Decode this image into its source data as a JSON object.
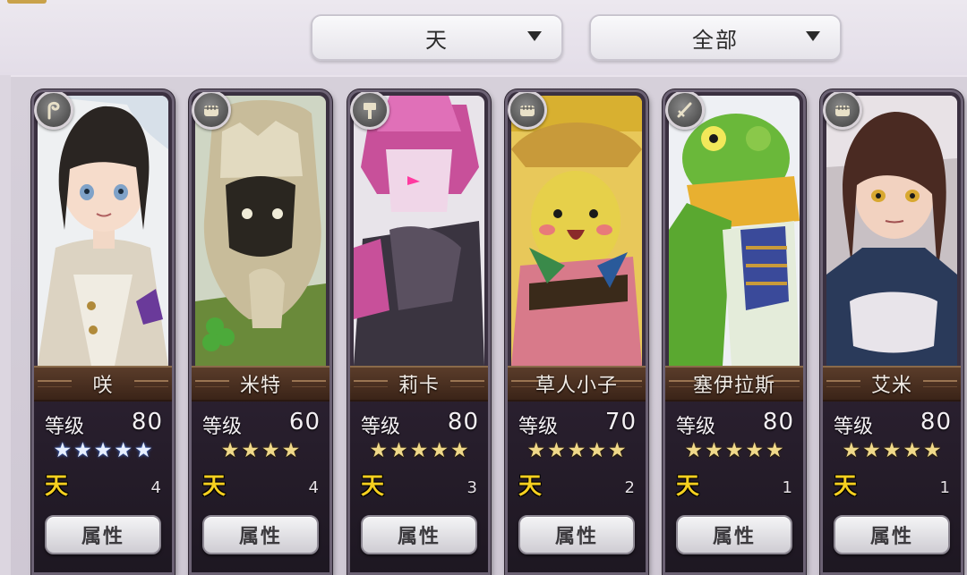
{
  "filters": {
    "rarity": {
      "selected": "天"
    },
    "category": {
      "selected": "全部"
    }
  },
  "level_label": "等级",
  "attr_label": "属性",
  "rank_badge": "天",
  "colors": {
    "card_border": "#6c6274",
    "name_bar": "#4a301f",
    "star_gold": "#f0d98a",
    "star_blue": "#e8f0ff",
    "rank_badge": "#f6d020"
  },
  "cards": [
    {
      "name": "咲",
      "level": "80",
      "stars": 5,
      "star_style": "blue",
      "count": "4",
      "type_icon": "whip-icon"
    },
    {
      "name": "米特",
      "level": "60",
      "stars": 4,
      "star_style": "gold",
      "count": "4",
      "type_icon": "fist-icon"
    },
    {
      "name": "莉卡",
      "level": "80",
      "stars": 5,
      "star_style": "gold",
      "count": "3",
      "type_icon": "hammer-icon"
    },
    {
      "name": "草人小子",
      "level": "70",
      "stars": 5,
      "star_style": "gold",
      "count": "2",
      "type_icon": "fist-icon"
    },
    {
      "name": "塞伊拉斯",
      "level": "80",
      "stars": 5,
      "star_style": "gold",
      "count": "1",
      "type_icon": "sword-icon"
    },
    {
      "name": "艾米",
      "level": "80",
      "stars": 5,
      "star_style": "gold",
      "count": "1",
      "type_icon": "fist-icon"
    }
  ]
}
